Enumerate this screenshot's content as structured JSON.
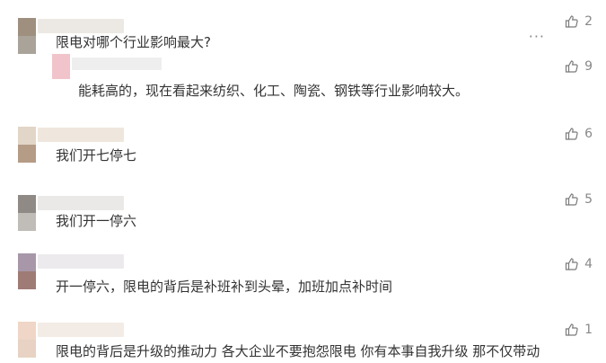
{
  "comments": [
    {
      "text": "限电对哪个行业影响最大?",
      "likes": "2",
      "avatar_colors": [
        "#9f8f7f",
        "#a9a39a"
      ],
      "nick_color": "#ece8e4"
    },
    {
      "text": "我们开七停七",
      "likes": "6",
      "avatar_colors": [
        "#e2d6c8",
        "#b59c86"
      ],
      "nick_color": "#efe7dd"
    },
    {
      "text": "我们开一停六",
      "likes": "5",
      "avatar_colors": [
        "#8f8a85",
        "#c0bcb8"
      ],
      "nick_color": "#ebe9e7"
    },
    {
      "text": "开一停六，限电的背后是补班补到头晕，加班加点补时间",
      "likes": "4",
      "avatar_colors": [
        "#a797a9",
        "#9e7b75"
      ],
      "nick_color": "#eceaed"
    },
    {
      "text": "限电的背后是升级的推动力  各大企业不要抱怨限电  你有本事自我升级  那不仅带动",
      "likes": "1",
      "avatar_colors": [
        "#f0d6c6",
        "#e7d2c3"
      ],
      "nick_color": "#f3ece6"
    }
  ],
  "reply": {
    "text": "能耗高的，现在看起来纺织、化工、陶瓷、钢铁等行业影响较大。",
    "likes": "9",
    "avatar_color": "#f1c4cc",
    "nick_color": "#efeeee"
  },
  "more_label": "···",
  "icons": {
    "like": "thumbs-up-icon",
    "more": "more-icon"
  }
}
